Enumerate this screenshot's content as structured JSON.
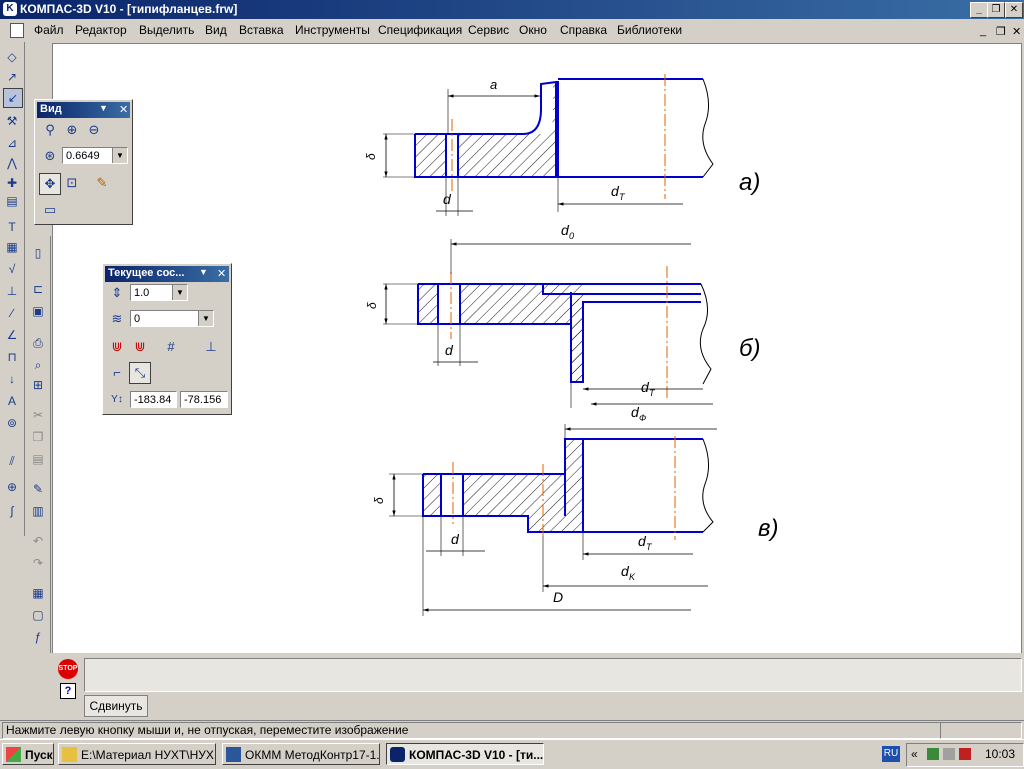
{
  "window": {
    "title": "КОМПАС-3D V10 - [типифланцев.frw]",
    "app_icon": "kompas-icon",
    "controls": [
      "_",
      "❐",
      "✕"
    ]
  },
  "menu": {
    "items": [
      "Файл",
      "Редактор",
      "Выделить",
      "Вид",
      "Вставка",
      "Инструменты",
      "Спецификация",
      "Сервис",
      "Окно",
      "Справка",
      "Библиотеки"
    ],
    "doc_controls": [
      "_",
      "❐",
      "✕"
    ]
  },
  "view_panel": {
    "title": "Вид",
    "zoom_value": "0.6649",
    "icons": [
      "zoom-window-icon",
      "zoom-in-icon",
      "zoom-out-icon",
      "zoom-scale-icon",
      "pan-icon",
      "show-all-icon",
      "refresh-icon",
      "layout-icon"
    ]
  },
  "state_panel": {
    "title": "Текущее сос...",
    "step_value": "1.0",
    "layer_value": "0",
    "coord_x": "-183.84",
    "coord_y": "-78.156"
  },
  "drawing": {
    "labels_a": {
      "a": "a",
      "delta": "δ",
      "d": "d",
      "dT": "d",
      "dT_sub": "T",
      "caption": "а)"
    },
    "labels_b": {
      "d0": "d",
      "d0_sub": "0",
      "delta": "δ",
      "d": "d",
      "dT": "d",
      "dT_sub": "T",
      "caption": "б)",
      "dF": "d",
      "dF_sub": "Ф"
    },
    "labels_v": {
      "delta": "δ",
      "d": "d",
      "dT": "d",
      "dT_sub": "T",
      "dK": "d",
      "dK_sub": "K",
      "D": "D",
      "caption": "в)"
    },
    "colors": {
      "contour": "#0000cc",
      "thin": "#000000",
      "axis": "#e06000"
    }
  },
  "command_panel": {
    "tab_label": "Сдвинуть",
    "stop_icon": "STOP",
    "help_icon": "?"
  },
  "status": {
    "message": "Нажмите левую кнопку мыши и, не отпуская, переместите изображение"
  },
  "taskbar": {
    "start": "Пуск",
    "tasks": [
      "E:\\Материал НУХТ\\НУХ...",
      "ОКММ МетодКонтр17-1...",
      "КОМПАС-3D V10 - [ти..."
    ],
    "lang": "RU",
    "clock": "10:03",
    "tray_arrow": "«"
  }
}
